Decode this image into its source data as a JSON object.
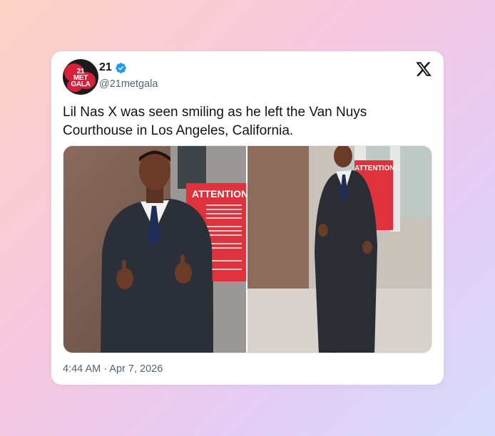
{
  "author": {
    "avatar_text": [
      "21",
      "MET",
      "GALA"
    ],
    "display_name": "21",
    "handle": "@21metgala",
    "verified": true
  },
  "tweet": {
    "text": "Lil Nas X was seen smiling as he left the Van Nuys Courthouse in Los Angeles, California.",
    "timestamp": "4:44 AM · Apr 7, 2026"
  },
  "media": {
    "sign_text": "ATTENTION"
  },
  "icons": {
    "platform": "x-logo-icon",
    "badge": "verified-badge-icon"
  },
  "colors": {
    "card_bg": "#ffffff",
    "text": "#0f1419",
    "secondary": "#536471",
    "verified": "#1d9bf0",
    "sign_red": "#d8303a"
  }
}
